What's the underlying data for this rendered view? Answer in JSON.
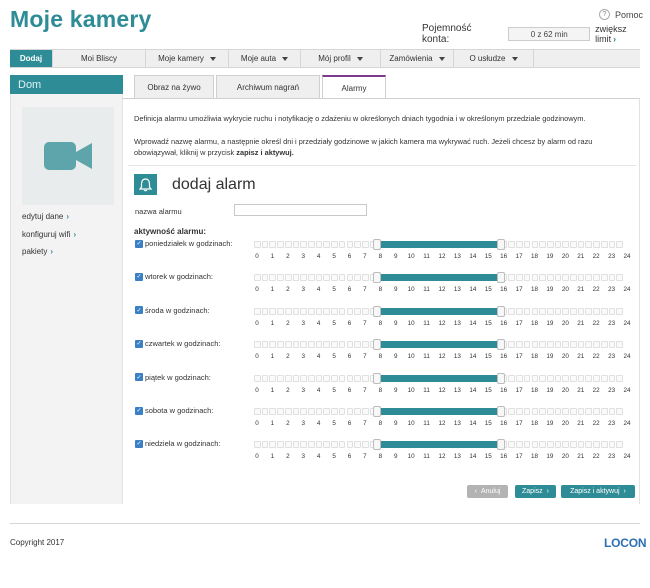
{
  "header": {
    "title": "Moje kamery",
    "help_label": "Pomoc",
    "help_icon": "?",
    "quota_label": "Pojemność konta:",
    "quota_value": "0 z 62 min",
    "increase_link": "zwiększ limit",
    "arrow": "›"
  },
  "nav": [
    {
      "label": "Dodaj",
      "active": true,
      "dropdown": false
    },
    {
      "label": "Moi Bliscy",
      "active": false,
      "dropdown": false
    },
    {
      "label": "Moje kamery",
      "active": false,
      "dropdown": true
    },
    {
      "label": "Moje auta",
      "active": false,
      "dropdown": true
    },
    {
      "label": "Mój profil",
      "active": false,
      "dropdown": true
    },
    {
      "label": "Zamówienia",
      "active": false,
      "dropdown": true
    },
    {
      "label": "O usłudze",
      "active": false,
      "dropdown": true
    }
  ],
  "sidebar": {
    "title": "Dom",
    "links": [
      {
        "label": "edytuj dane",
        "arrow": "›"
      },
      {
        "label": "konfiguruj wifi",
        "arrow": "›"
      },
      {
        "label": "pakiety",
        "arrow": "›"
      }
    ]
  },
  "tabs": [
    {
      "label": "Obraz na żywo",
      "active": false
    },
    {
      "label": "Archiwum nagrań",
      "active": false
    },
    {
      "label": "Alarmy",
      "active": true
    }
  ],
  "content": {
    "desc1": "Definicja alarmu umożliwia wykrycie ruchu i notyfikację o zdażeniu w określonych dniach tygodnia i w określonym przedziale godzinowym.",
    "desc2a": "Wprowadź nazwę alarmu, a następnie określ dni i przedziały godzinowe w jakich kamera ma wykrywać ruch. Jeżeli chcesz by alarm od razu obowiązywał, kliknij w przycisk ",
    "desc2b": "zapisz i aktywuj.",
    "add_title": "dodaj alarm",
    "name_label": "nazwa alarmu",
    "name_value": "",
    "activity_label": "aktywność alarmu:",
    "hours": [
      "0",
      "1",
      "2",
      "3",
      "4",
      "5",
      "6",
      "7",
      "8",
      "9",
      "10",
      "11",
      "12",
      "13",
      "14",
      "15",
      "16",
      "17",
      "18",
      "19",
      "20",
      "21",
      "22",
      "23",
      "24"
    ],
    "days": [
      {
        "label": "poniedziałek w godzinach:",
        "checked": true,
        "start": 8,
        "end": 16
      },
      {
        "label": "wtorek w godzinach:",
        "checked": true,
        "start": 8,
        "end": 16
      },
      {
        "label": "środa w godzinach:",
        "checked": true,
        "start": 8,
        "end": 16
      },
      {
        "label": "czwartek w godzinach:",
        "checked": true,
        "start": 8,
        "end": 16
      },
      {
        "label": "piątek w godzinach:",
        "checked": true,
        "start": 8,
        "end": 16
      },
      {
        "label": "sobota w godzinach:",
        "checked": true,
        "start": 8,
        "end": 16
      },
      {
        "label": "niedziela w godzinach:",
        "checked": true,
        "start": 8,
        "end": 16
      }
    ]
  },
  "buttons": {
    "back": "Anuluj",
    "back_arrow": "‹",
    "save": "Zapisz",
    "save_arrow": "›",
    "save_activate": "Zapisz i aktywuj",
    "save_activate_arrow": "›"
  },
  "footer": {
    "copyright": "Copyright 2017",
    "logo": "LOCON"
  },
  "colors": {
    "accent": "#2e8c96",
    "active_tab_border": "#7c3a8e",
    "logo": "#2e6fb4"
  }
}
